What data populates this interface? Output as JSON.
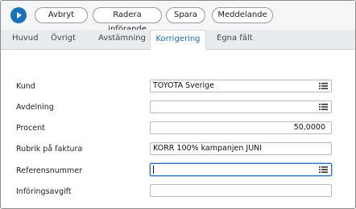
{
  "toolbar": {
    "run_icon": "play-icon",
    "buttons": [
      "Avbryt",
      "Radera införande",
      "Spara",
      "Meddelande"
    ]
  },
  "tabs": [
    "Huvud",
    "Övrigt",
    "Avstämning",
    "Korrigering",
    "Egna fält"
  ],
  "active_tab": "Korrigering",
  "form": {
    "kund": {
      "label": "Kund",
      "value": "TOYOTA Sverige"
    },
    "avdelning": {
      "label": "Avdelning",
      "value": ""
    },
    "procent": {
      "label": "Procent",
      "value": "50,0000"
    },
    "rubrik": {
      "label": "Rubrik på faktura",
      "value": "KORR 100% kampanjen JUNI"
    },
    "referens": {
      "label": "Referensnummer",
      "value": ""
    },
    "avgift": {
      "label": "Införingsavgift",
      "value": ""
    }
  },
  "colors": {
    "accent": "#1a73b8",
    "active_tab_text": "#1a6fb0"
  }
}
